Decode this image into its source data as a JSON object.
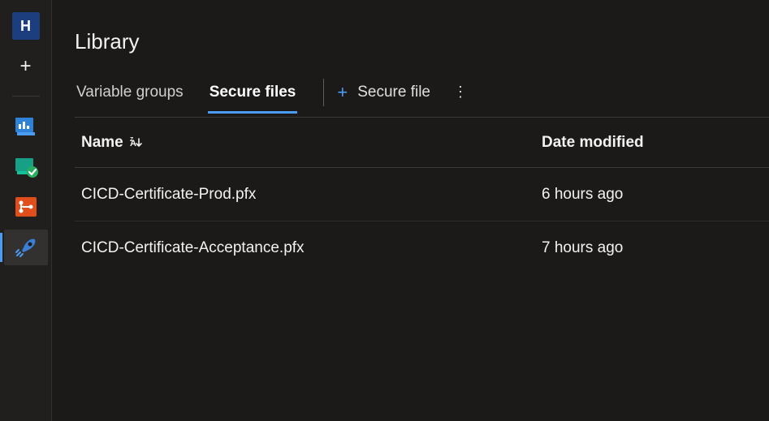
{
  "sidebar": {
    "project_letter": "H"
  },
  "page": {
    "title": "Library"
  },
  "tabs": [
    {
      "label": "Variable groups",
      "active": false
    },
    {
      "label": "Secure files",
      "active": true
    }
  ],
  "actions": {
    "add_label": "Secure file"
  },
  "columns": {
    "name": "Name",
    "date": "Date modified"
  },
  "files": [
    {
      "name": "CICD-Certificate-Prod.pfx",
      "modified": "6 hours ago"
    },
    {
      "name": "CICD-Certificate-Acceptance.pfx",
      "modified": "7 hours ago"
    }
  ]
}
